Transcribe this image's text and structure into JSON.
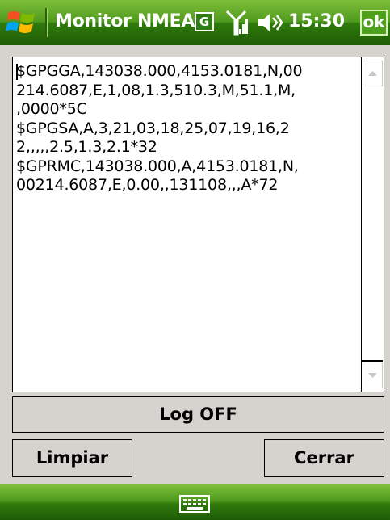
{
  "titlebar": {
    "app_title": "Monitor NMEA",
    "network_letter": "G",
    "time": "15:30",
    "ok_label": "ok",
    "icons": [
      "windows-start-icon",
      "signal-icon",
      "volume-icon"
    ]
  },
  "main": {
    "nmea_text": "$GPGGA,143038.000,4153.0181,N,00\n214.6087,E,1,08,1.3,510.3,M,51.1,M,\n,0000*5C\n$GPGSA,A,3,21,03,18,25,07,19,16,2\n2,,,,,2.5,1.3,2.1*32\n$GPRMC,143038.000,A,4153.0181,N,\n00214.6087,E,0.00,,131108,,,A*72"
  },
  "buttons": {
    "log_label": "Log OFF",
    "clear_label": "Limpiar",
    "close_label": "Cerrar"
  },
  "bottombar": {
    "icon": "keyboard-icon"
  },
  "colors": {
    "bar_green": "#4e9a1e",
    "form_gray": "#d6d3ce"
  }
}
